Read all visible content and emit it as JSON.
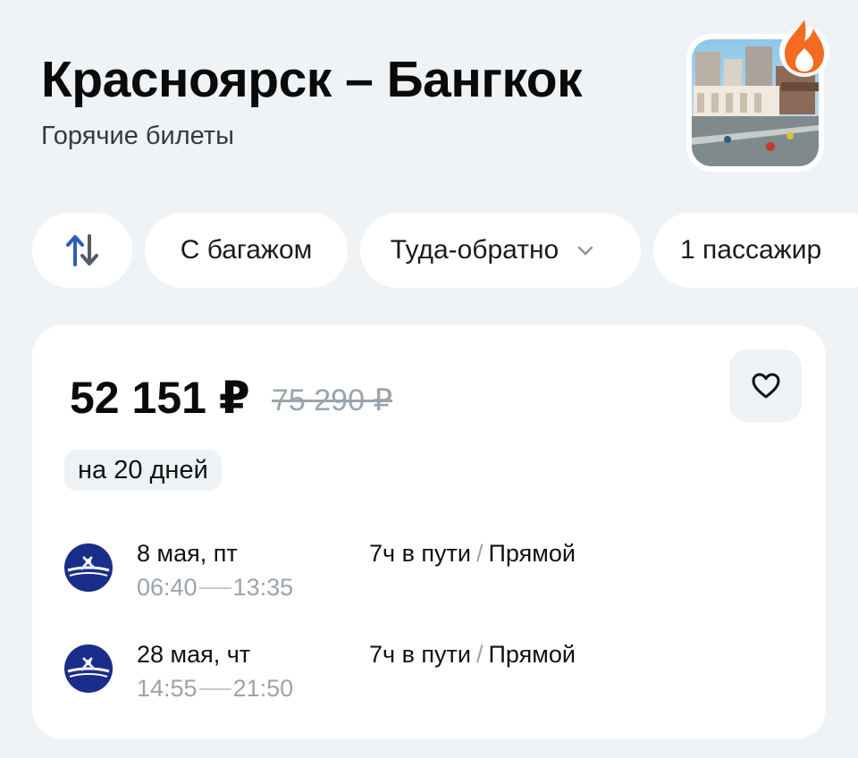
{
  "header": {
    "title": "Красноярск – Бангкок",
    "subtitle": "Горячие билеты",
    "hero_image": "bangkok-city-street-photo",
    "badge_icon": "fire-icon"
  },
  "filters": {
    "swap_icon": "swap-arrows-icon",
    "baggage_label": "С багажом",
    "trip_type_label": "Туда-обратно",
    "passengers_label": "1 пассажир"
  },
  "offer": {
    "price": "52 151 ₽",
    "old_price": "75 290 ₽",
    "duration_badge": "на 20 дней",
    "favorite_icon": "heart-icon",
    "segments": [
      {
        "airline_logo": "aeroflot-logo",
        "date": "8 мая, пт",
        "depart": "06:40",
        "arrive": "13:35",
        "duration": "7ч в пути",
        "stops": "Прямой"
      },
      {
        "airline_logo": "aeroflot-logo",
        "date": "28 мая, чт",
        "depart": "14:55",
        "arrive": "21:50",
        "duration": "7ч в пути",
        "stops": "Прямой"
      }
    ]
  },
  "colors": {
    "background": "#f0f3f6",
    "card": "#ffffff",
    "accent_blue": "#1a5fd0",
    "fire_orange": "#f26b21",
    "muted_text": "#9aa4ad",
    "airline_blue": "#1b2d8a"
  }
}
